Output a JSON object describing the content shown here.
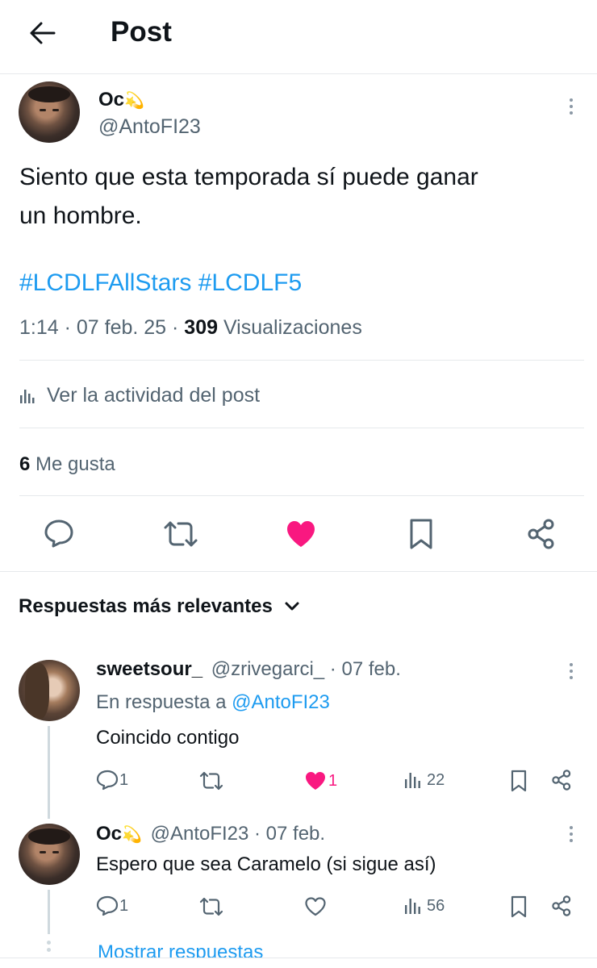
{
  "header": {
    "title": "Post"
  },
  "post": {
    "author_name": "Oc",
    "author_emoji": "💫",
    "author_handle": "@AntoFI23",
    "text_line1": "Siento que esta temporada sí puede ganar",
    "text_line2": "un hombre.",
    "hashtags": "#LCDLFAllStars #LCDLF5",
    "time": "1:14 · 07 feb. 25 · ",
    "views_count": "309",
    "views_label": " Visualizaciones",
    "activity_label": "Ver la actividad del post",
    "likes_count": "6",
    "likes_label": " Me gusta"
  },
  "replies_header": "Respuestas más relevantes",
  "replies": [
    {
      "name": "sweetsour_",
      "handle_date": "@zrivegarci_ · 07 feb.",
      "reply_to_prefix": "En respuesta a ",
      "reply_to_handle": "@AntoFI23",
      "text": "Coincido contigo",
      "comments": "1",
      "likes": "1",
      "liked": true,
      "views": "22"
    },
    {
      "name": "Oc",
      "name_emoji": "💫",
      "handle_date": "@AntoFI23 · 07 feb.",
      "text": "Espero que sea Caramelo (si sigue así)",
      "comments": "1",
      "likes": "",
      "liked": false,
      "views": "56"
    }
  ],
  "show_replies": "Mostrar respuestas",
  "colors": {
    "accent": "#1d9bf0",
    "like": "#f91880",
    "muted": "#536471"
  }
}
